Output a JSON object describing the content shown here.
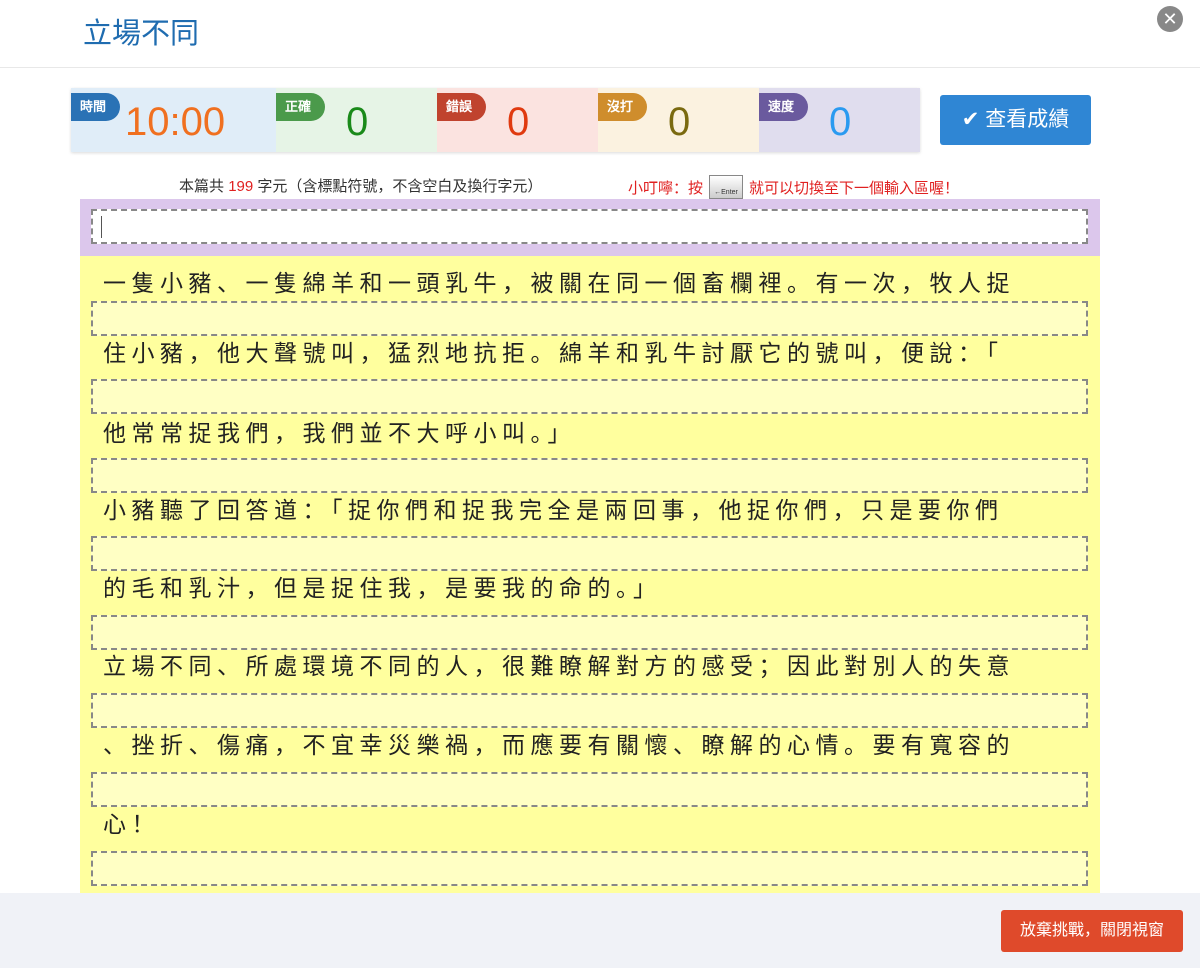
{
  "title": "立場不同",
  "stats": [
    {
      "label": "時間",
      "value": "10:00",
      "badge": "#2a72b5",
      "bg": "#e0edf8",
      "color": "#f07020"
    },
    {
      "label": "正確",
      "value": "0",
      "badge": "#4b9a4b",
      "bg": "#e6f4e6",
      "color": "#1a8a1a"
    },
    {
      "label": "錯誤",
      "value": "0",
      "badge": "#c0432e",
      "bg": "#fbe3e0",
      "color": "#e03a10"
    },
    {
      "label": "沒打",
      "value": "0",
      "badge": "#cf8d2c",
      "bg": "#fbf2e0",
      "color": "#7a6a10"
    },
    {
      "label": "速度",
      "value": "0",
      "badge": "#6a5a9e",
      "bg": "#e0ddee",
      "color": "#2a9af0"
    }
  ],
  "score_button": "查看成績",
  "info": {
    "prefix": "本篇共",
    "count": "199",
    "suffix": "字元（含標點符號，不含空白及換行字元）"
  },
  "hint": {
    "before": "小叮嚀：按",
    "key": "←Enter",
    "after": "就可以切換至下一個輸入區喔！"
  },
  "lines": [
    "一隻小豬、一隻綿羊和一頭乳牛，被關在同一個畜欄裡。有一次，牧人捉",
    "住小豬，他大聲號叫，猛烈地抗拒。綿羊和乳牛討厭它的號叫，便說：「",
    "他常常捉我們，我們並不大呼小叫。」",
    "小豬聽了回答道：「捉你們和捉我完全是兩回事，他捉你們，只是要你們",
    "的毛和乳汁，但是捉住我，是要我的命的。」",
    "立場不同、所處環境不同的人，很難瞭解對方的感受；因此對別人的失意",
    "、挫折、傷痛，不宜幸災樂禍，而應要有關懷、瞭解的心情。要有寬容的",
    "心！"
  ],
  "quit_button": "放棄挑戰，關閉視窗"
}
